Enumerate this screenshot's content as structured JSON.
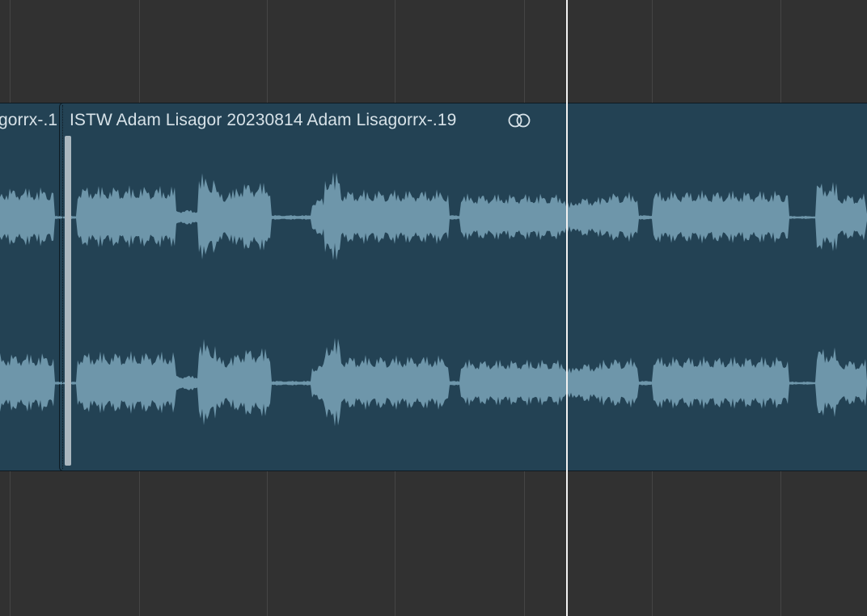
{
  "regions": [
    {
      "id": "left",
      "name": "gorrx-.1"
    },
    {
      "id": "main",
      "name": "ISTW Adam Lisagor 20230814 Adam Lisagorrx-.19"
    }
  ],
  "icons": {
    "loop": "loop-rings-icon",
    "edit_handle": "region-cut-handle"
  },
  "colors": {
    "background": "#313131",
    "grid": "#454545",
    "region_fill": "#234254",
    "waveform": "#6e96aa",
    "region_text": "#d7e2e8",
    "playhead": "#f2f2f2"
  },
  "channels": 2
}
